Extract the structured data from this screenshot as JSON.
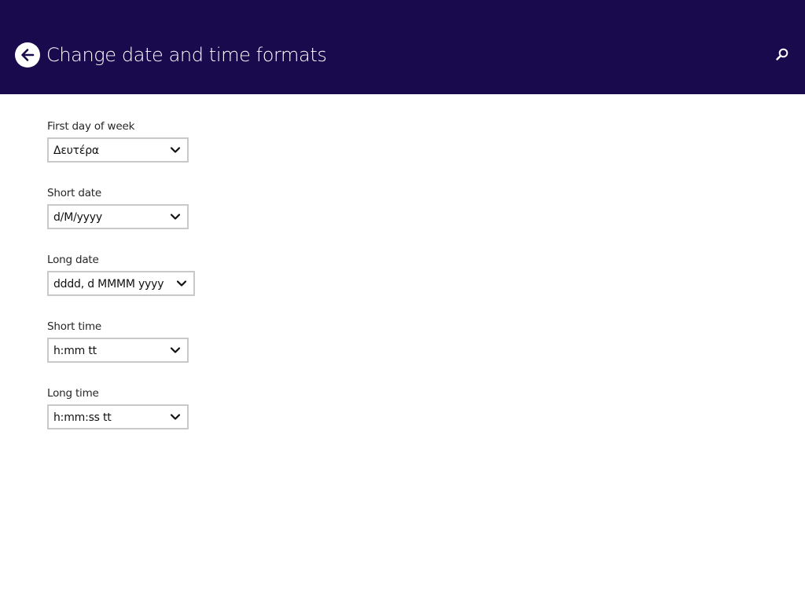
{
  "header": {
    "title": "Change date and time formats",
    "back_icon": "back-arrow-icon",
    "search_icon": "search-icon",
    "background_color": "#180a4c"
  },
  "fields": [
    {
      "label": "First day of week",
      "value": "Δευτέρα"
    },
    {
      "label": "Short date",
      "value": "d/M/yyyy"
    },
    {
      "label": "Long date",
      "value": "dddd, d MMMM yyyy"
    },
    {
      "label": "Short time",
      "value": "h:mm tt"
    },
    {
      "label": "Long time",
      "value": "h:mm:ss tt"
    }
  ],
  "dropdown_icon": "chevron-down-icon"
}
